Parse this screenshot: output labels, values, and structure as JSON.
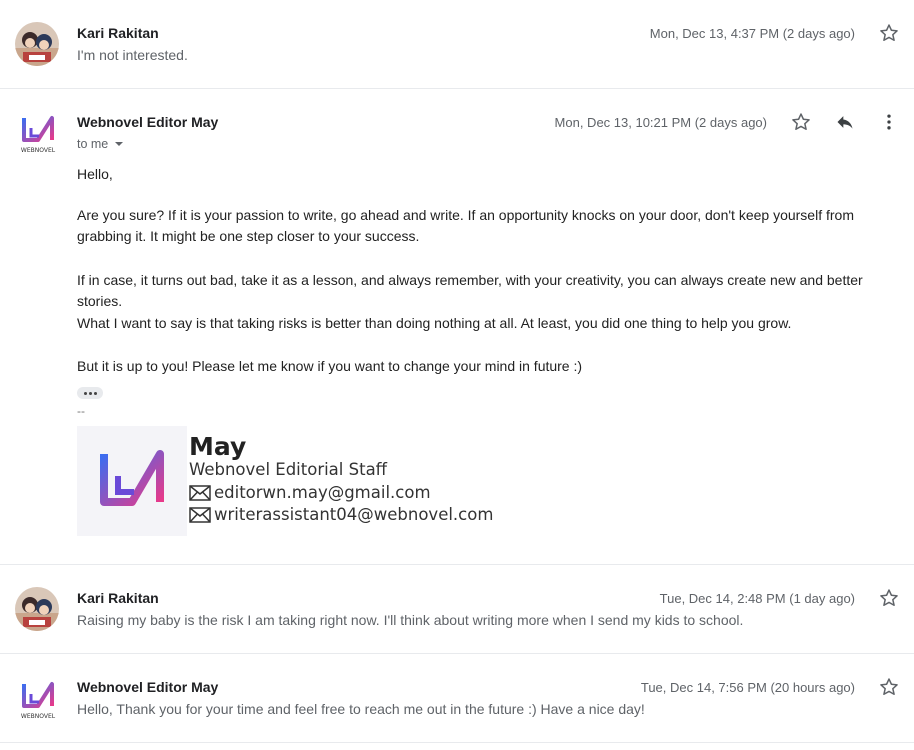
{
  "messages": [
    {
      "sender": "Kari Rakitan",
      "date": "Mon, Dec 13, 4:37 PM (2 days ago)",
      "snippet": "I'm not interested."
    },
    {
      "sender": "Webnovel Editor May",
      "date": "Mon, Dec 13, 10:21 PM (2 days ago)",
      "to_label": "to me",
      "avatar_text": "WEBNOVEL",
      "body": [
        "Hello,",
        "Are you sure? If it is your passion to write, go ahead and write. If an opportunity knocks on your door, don't keep yourself from grabbing it. It might be one step closer to your success.",
        "If in case, it turns out bad, take it as a lesson, and always remember, with your creativity, you can always create new and better stories.",
        "What I want to say is that taking risks is better than doing nothing at all. At least, you did one thing to help you grow.",
        "But it is up to you! Please let me know if you want to change your mind in future :)"
      ],
      "sig_separator": "--",
      "signature": {
        "name": "May",
        "title": "Webnovel Editorial Staff",
        "email1": "editorwn.may@gmail.com",
        "email2": "writerassistant04@webnovel.com"
      }
    },
    {
      "sender": "Kari Rakitan",
      "date": "Tue, Dec 14, 2:48 PM (1 day ago)",
      "snippet": "Raising my baby is the risk I am taking right now. I'll think about writing more when I send my kids to school."
    },
    {
      "sender": "Webnovel Editor May",
      "date": "Tue, Dec 14, 7:56 PM (20 hours ago)",
      "avatar_text": "WEBNOVEL",
      "snippet": "Hello, Thank you for your time and feel free to reach me out in the future :) Have a nice day!"
    }
  ],
  "colors": {
    "brand_gradient_start": "#3b6df0",
    "brand_gradient_end": "#e8398a",
    "text_secondary": "#5f6368"
  }
}
